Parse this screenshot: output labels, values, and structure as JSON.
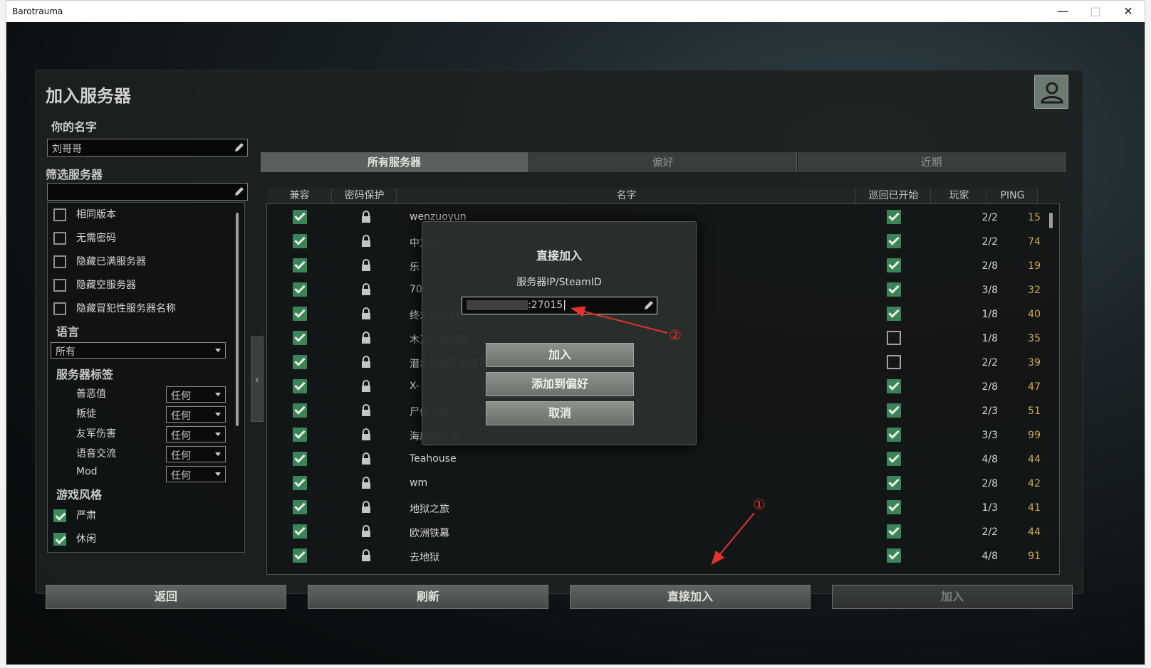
{
  "window": {
    "title": "Barotrauma"
  },
  "page": {
    "title": "加入服务器",
    "name_label": "你的名字",
    "name_value": "刘哥哥",
    "filter_label": "筛选服务器",
    "filter_value": ""
  },
  "filters": {
    "checkboxes": [
      {
        "label": "相同版本",
        "checked": false
      },
      {
        "label": "无需密码",
        "checked": false
      },
      {
        "label": "隐藏已满服务器",
        "checked": false
      },
      {
        "label": "隐藏空服务器",
        "checked": false
      },
      {
        "label": "隐藏冒犯性服务器名称",
        "checked": false
      }
    ],
    "language_label": "语言",
    "language_value": "所有",
    "tags_label": "服务器标签",
    "tags": [
      {
        "label": "善恶值",
        "value": "任何"
      },
      {
        "label": "叛徒",
        "value": "任何"
      },
      {
        "label": "友军伤害",
        "value": "任何"
      },
      {
        "label": "语音交流",
        "value": "任何"
      },
      {
        "label": "Mod",
        "value": "任何"
      }
    ],
    "style_label": "游戏风格",
    "styles": [
      {
        "label": "严肃",
        "checked": true
      },
      {
        "label": "休闲",
        "checked": true
      }
    ]
  },
  "tabs": [
    "所有服务器",
    "偏好",
    "近期"
  ],
  "columns": [
    "兼容",
    "密码保护",
    "名字",
    "巡回已开始",
    "玩家",
    "PING"
  ],
  "servers": [
    {
      "name": "wenzuoyun",
      "compat": true,
      "locked": true,
      "started": true,
      "players": "2/2",
      "ping": "15"
    },
    {
      "name": "中文版",
      "compat": true,
      "locked": true,
      "started": true,
      "players": "2/2",
      "ping": "74"
    },
    {
      "name": "乐",
      "compat": true,
      "locked": true,
      "started": true,
      "players": "2/8",
      "ping": "19"
    },
    {
      "name": "70",
      "compat": true,
      "locked": true,
      "started": true,
      "players": "3/8",
      "ping": "32"
    },
    {
      "name": "终末地计划",
      "compat": true,
      "locked": true,
      "started": true,
      "players": "1/8",
      "ping": "40"
    },
    {
      "name": "木卫二旅游团",
      "compat": true,
      "locked": true,
      "started": false,
      "players": "1/8",
      "ping": "35"
    },
    {
      "name": "潜水员的不妙冒险",
      "compat": true,
      "locked": true,
      "started": false,
      "players": "2/2",
      "ping": "39"
    },
    {
      "name": "X-",
      "compat": true,
      "locked": true,
      "started": true,
      "players": "2/8",
      "ping": "47"
    },
    {
      "name": "尸体派对",
      "compat": true,
      "locked": true,
      "started": true,
      "players": "2/3",
      "ping": "51"
    },
    {
      "name": "海底两万里",
      "compat": true,
      "locked": true,
      "started": true,
      "players": "3/3",
      "ping": "99"
    },
    {
      "name": "Teahouse",
      "compat": true,
      "locked": true,
      "started": true,
      "players": "4/8",
      "ping": "44"
    },
    {
      "name": "wm",
      "compat": true,
      "locked": true,
      "started": true,
      "players": "2/8",
      "ping": "42"
    },
    {
      "name": "地狱之旅",
      "compat": true,
      "locked": true,
      "started": true,
      "players": "1/3",
      "ping": "41"
    },
    {
      "name": "欧洲铁幕",
      "compat": true,
      "locked": true,
      "started": true,
      "players": "2/2",
      "ping": "44"
    },
    {
      "name": "去地狱",
      "compat": true,
      "locked": true,
      "started": true,
      "players": "4/8",
      "ping": "91"
    }
  ],
  "buttons": {
    "back": "返回",
    "refresh": "刷新",
    "direct": "直接加入",
    "join": "加入"
  },
  "dialog": {
    "title": "直接加入",
    "label": "服务器IP/SteamID",
    "value": ":27015",
    "join": "加入",
    "add_fav": "添加到偏好",
    "cancel": "取消"
  },
  "annotations": {
    "one": "①",
    "two": "②"
  },
  "colors": {
    "accent_green": "#3b8457",
    "ping": "#d2aa52",
    "arrow": "#e3322c"
  }
}
